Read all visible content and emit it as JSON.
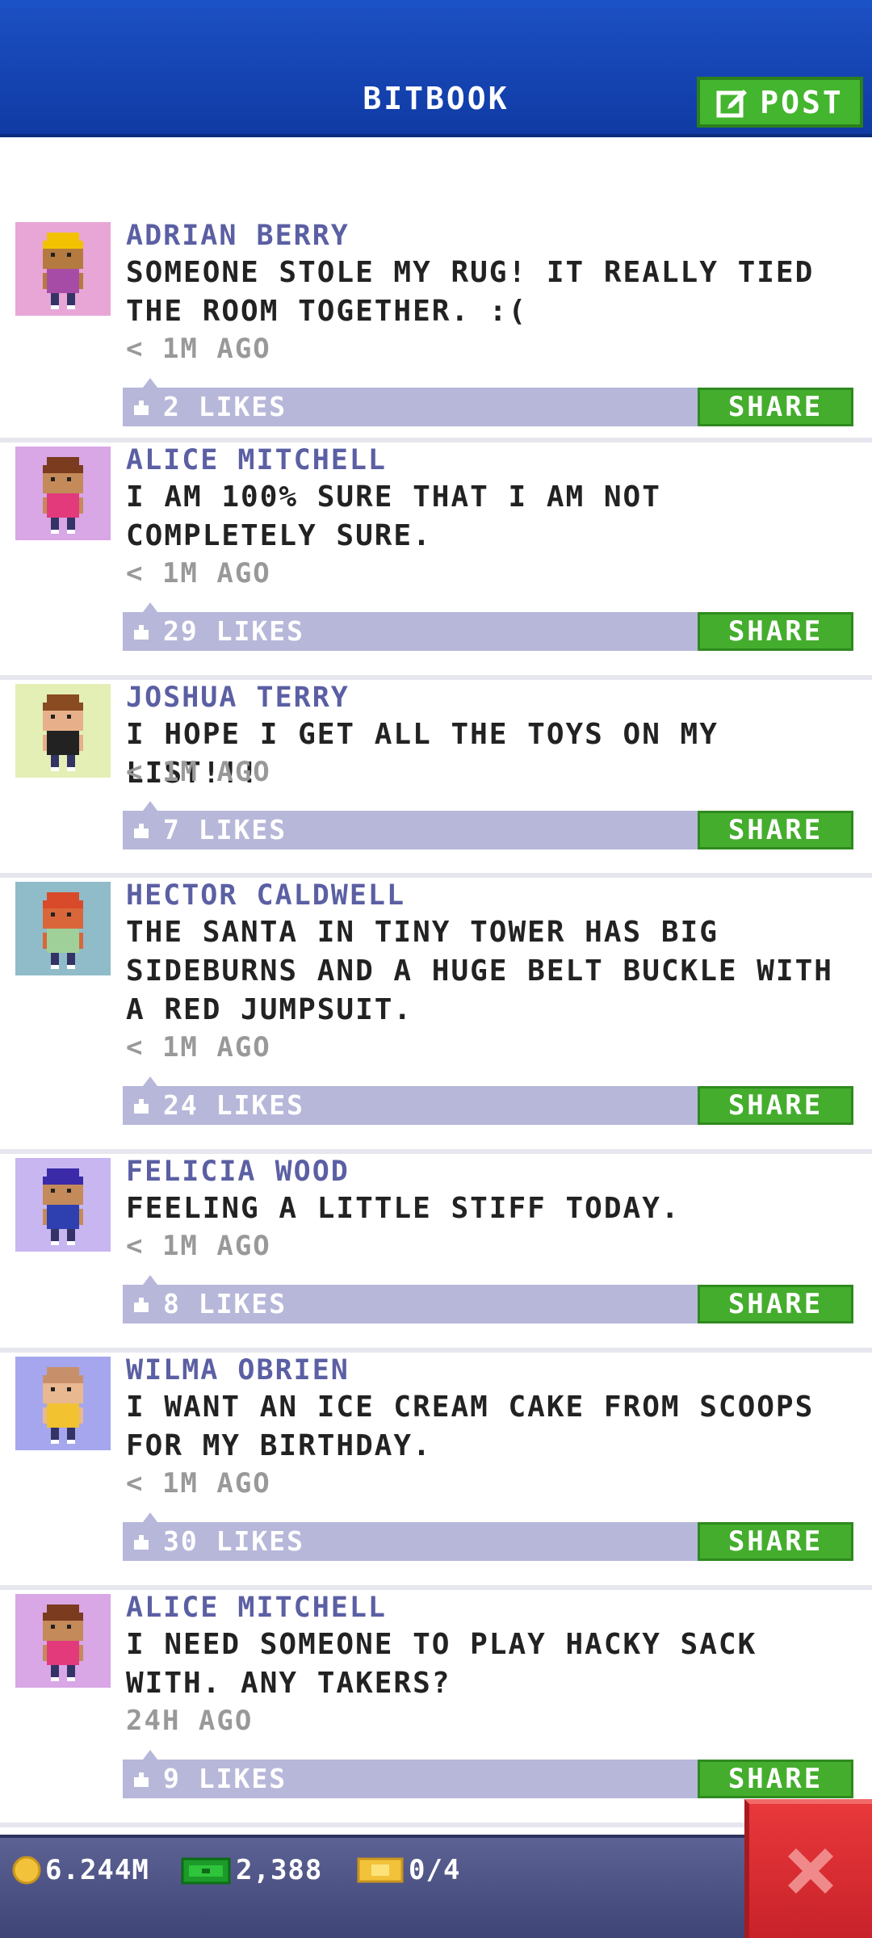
{
  "header": {
    "title": "BITBOOK",
    "post_label": "POST"
  },
  "posts": [
    {
      "name": "ADRIAN BERRY",
      "message": "SOMEONE STOLE MY RUG! IT REALLY TIED THE ROOM TOGETHER. :(",
      "time": "< 1M AGO",
      "likes": "2 LIKES",
      "share": "SHARE",
      "avatar_bg": "#e8a6d6",
      "hair": "#f2c200",
      "skin": "#b57a3f",
      "shirt": "#a64ca6"
    },
    {
      "name": "ALICE MITCHELL",
      "message": "I AM 100% SURE THAT I AM NOT COMPLETELY SURE.",
      "time": "< 1M AGO",
      "likes": "29 LIKES",
      "share": "SHARE",
      "avatar_bg": "#d9a6e6",
      "hair": "#7a3b1e",
      "skin": "#c58a5a",
      "shirt": "#e23a7a"
    },
    {
      "name": "JOSHUA TERRY",
      "message": "I HOPE I GET ALL THE TOYS ON MY LIST!!!",
      "time": "< 1M AGO",
      "likes": "7 LIKES",
      "share": "SHARE",
      "avatar_bg": "#e3efb5",
      "hair": "#8a4a22",
      "skin": "#e8b08a",
      "shirt": "#222222"
    },
    {
      "name": "HECTOR CALDWELL",
      "message": "THE SANTA IN TINY TOWER HAS BIG SIDEBURNS AND A HUGE BELT BUCKLE WITH A RED JUMPSUIT.",
      "time": "< 1M AGO",
      "likes": "24 LIKES",
      "share": "SHARE",
      "avatar_bg": "#8fbcc8",
      "hair": "#d94a2a",
      "skin": "#d9663a",
      "shirt": "#9fd09a"
    },
    {
      "name": "FELICIA WOOD",
      "message": "FEELING A LITTLE STIFF TODAY.",
      "time": "< 1M AGO",
      "likes": "8 LIKES",
      "share": "SHARE",
      "avatar_bg": "#c7b6f0",
      "hair": "#3a2aa8",
      "skin": "#c58a5a",
      "shirt": "#2e3fb0"
    },
    {
      "name": "WILMA OBRIEN",
      "message": "I WANT AN ICE CREAM CAKE FROM SCOOPS FOR MY BIRTHDAY.",
      "time": "< 1M AGO",
      "likes": "30 LIKES",
      "share": "SHARE",
      "avatar_bg": "#a6a6ee",
      "hair": "#c8906a",
      "skin": "#e8b890",
      "shirt": "#f2c230"
    },
    {
      "name": "ALICE MITCHELL",
      "message": "I NEED SOMEONE TO PLAY HACKY SACK WITH. ANY TAKERS?",
      "time": "24H AGO",
      "likes": "9 LIKES",
      "share": "SHARE",
      "avatar_bg": "#d9a6e6",
      "hair": "#7a3b1e",
      "skin": "#c58a5a",
      "shirt": "#e23a7a"
    }
  ],
  "status": {
    "coins": "6.244M",
    "bux": "2,388",
    "tickets": "0/4"
  },
  "colors": {
    "header_blue": "#1c4fc2",
    "share_green": "#44ad2d",
    "likes_bar": "#b7b7da",
    "close_red": "#d82a30"
  }
}
